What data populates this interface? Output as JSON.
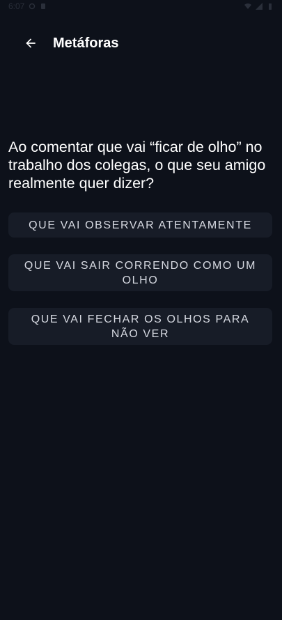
{
  "status_bar": {
    "time": "6:07"
  },
  "app_bar": {
    "title": "Metáforas",
    "back_icon": "arrow-back-icon"
  },
  "question": {
    "text": "Ao comentar que vai “ficar de olho” no trabalho dos colegas, o que seu amigo realmente quer dizer?"
  },
  "options": [
    {
      "label": "QUE VAI OBSERVAR ATENTAMENTE"
    },
    {
      "label": "QUE VAI SAIR CORRENDO COMO UM OLHO"
    },
    {
      "label": "QUE VAI FECHAR OS OLHOS PARA NÃO VER"
    }
  ],
  "colors": {
    "background": "#0d111a",
    "option_background": "#171c27",
    "option_text": "#d7dae2",
    "text": "#ffffff"
  }
}
